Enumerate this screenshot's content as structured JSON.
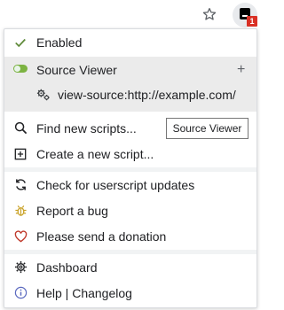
{
  "toolbar": {
    "star_icon": "star-outline-icon",
    "extension_icon": "tampermonkey-icon",
    "badge_count": "1",
    "badge_color": "#d93025"
  },
  "menu": {
    "enabled_label": "Enabled",
    "script": {
      "name": "Source Viewer",
      "plus": "+",
      "match_url": "view-source:http://example.com/",
      "toggle_color": "#7cb342"
    },
    "tooltip": "Source Viewer",
    "items_group1": [
      {
        "label": "Find new scripts...",
        "icon": "search-icon"
      },
      {
        "label": "Create a new script...",
        "icon": "add-box-icon"
      }
    ],
    "items_group2": [
      {
        "label": "Check for userscript updates",
        "icon": "refresh-icon"
      },
      {
        "label": "Report a bug",
        "icon": "bug-icon"
      },
      {
        "label": "Please send a donation",
        "icon": "heart-icon"
      }
    ],
    "items_group3": [
      {
        "label": "Dashboard",
        "icon": "gear-icon"
      },
      {
        "label": "Help | Changelog",
        "icon": "info-icon"
      }
    ],
    "colors": {
      "check": "#5f8a3a",
      "bug": "#c9a227",
      "heart": "#c0392b",
      "info": "#5b6abf"
    }
  }
}
